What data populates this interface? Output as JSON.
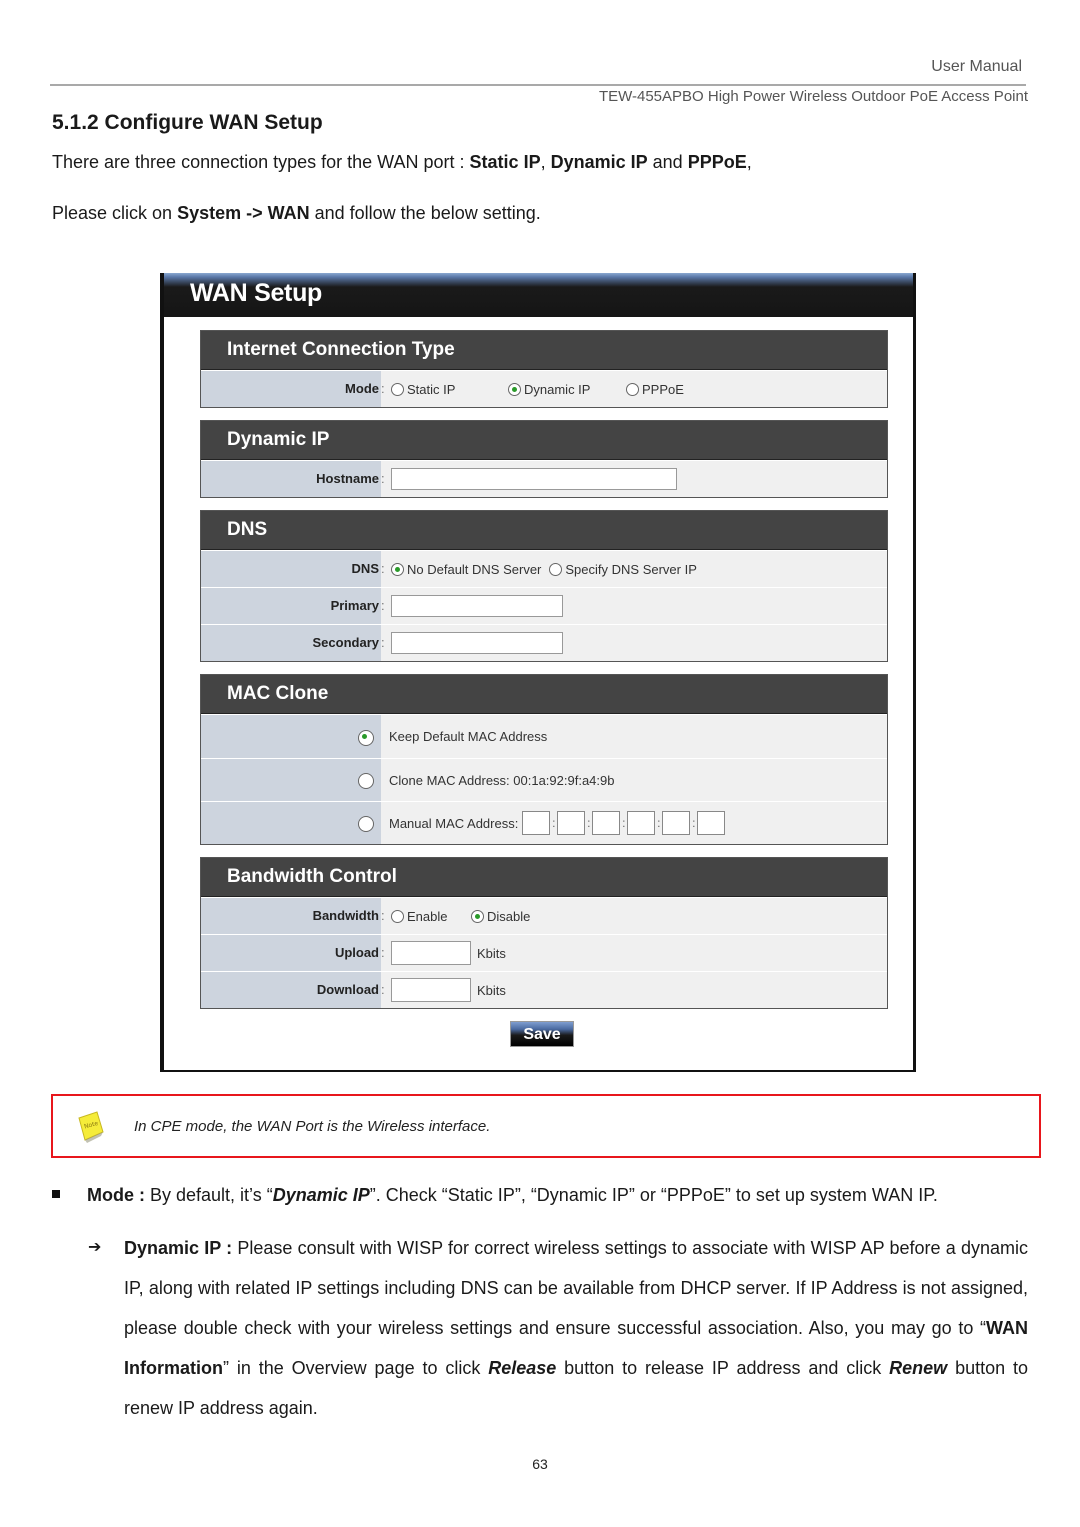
{
  "header": {
    "manual_label": "User Manual",
    "product": "TEW-455APBO High Power Wireless Outdoor PoE Access Point"
  },
  "section": {
    "title": "5.1.2 Configure WAN Setup",
    "intro": {
      "prefix": "There are three connection types for the WAN port : ",
      "type1": "Static IP",
      "sep1": ", ",
      "type2": "Dynamic IP",
      "sep2": " and ",
      "type3": "PPPoE",
      "suffix": ","
    },
    "instruction": {
      "prefix": "Please click on ",
      "path": "System -> WAN",
      "suffix": " and follow the below setting."
    }
  },
  "wan_setup": {
    "title": "WAN Setup",
    "connection_type": {
      "heading": "Internet Connection Type",
      "mode_label": "Mode",
      "options": [
        {
          "label": "Static IP",
          "selected": false
        },
        {
          "label": "Dynamic IP",
          "selected": true
        },
        {
          "label": "PPPoE",
          "selected": false
        }
      ]
    },
    "dynamic_ip": {
      "heading": "Dynamic IP",
      "hostname_label": "Hostname",
      "hostname_value": ""
    },
    "dns": {
      "heading": "DNS",
      "dns_label": "DNS",
      "options": [
        {
          "label": "No Default DNS Server",
          "selected": true
        },
        {
          "label": "Specify DNS Server IP",
          "selected": false
        }
      ],
      "primary_label": "Primary",
      "primary_value": "",
      "secondary_label": "Secondary",
      "secondary_value": ""
    },
    "mac_clone": {
      "heading": "MAC Clone",
      "options": [
        {
          "label": "Keep Default MAC Address",
          "selected": true
        },
        {
          "label": "Clone MAC Address: 00:1a:92:9f:a4:9b",
          "selected": false
        },
        {
          "label": "Manual MAC Address:",
          "selected": false
        }
      ],
      "manual_octets": [
        "",
        "",
        "",
        "",
        "",
        ""
      ]
    },
    "bandwidth": {
      "heading": "Bandwidth Control",
      "bandwidth_label": "Bandwidth",
      "options": [
        {
          "label": "Enable",
          "selected": false
        },
        {
          "label": "Disable",
          "selected": true
        }
      ],
      "upload_label": "Upload",
      "upload_value": "",
      "download_label": "Download",
      "download_value": "",
      "unit": "Kbits"
    },
    "save_label": "Save"
  },
  "note": {
    "icon": "sticky-note-icon",
    "text": "In CPE mode, the WAN Port is the Wireless interface."
  },
  "body": {
    "mode_bullet": {
      "label": "Mode :",
      "text1": " By default, it’s “",
      "emph": "Dynamic IP",
      "text2": "”. Check “Static IP”, “Dynamic IP” or “PPPoE” to set up system WAN IP."
    },
    "dynamic_ip_item": {
      "label": "Dynamic IP :",
      "text1": " Please consult with WISP for correct wireless settings to associate with WISP AP before a dynamic IP, along with related IP settings including DNS can be available from DHCP server. If IP Address is not assigned, please double check with your wireless settings and ensure successful association.  Also, you may go to “",
      "wan_info": "WAN Information",
      "text2": "” in the Overview page to click ",
      "release": "Release",
      "text3": " button to release IP address and click ",
      "renew": "Renew",
      "text4": " button to renew IP address again."
    }
  },
  "page_number": "63"
}
